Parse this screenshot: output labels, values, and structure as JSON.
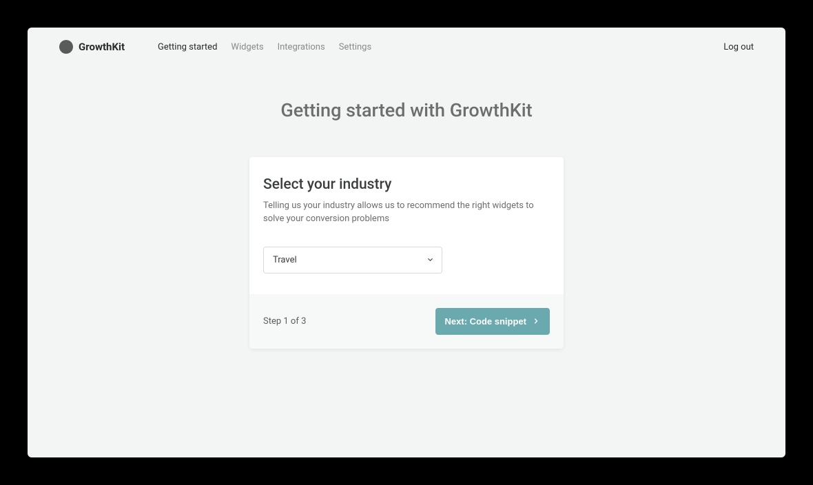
{
  "brand": "GrowthKit",
  "nav": {
    "items": [
      {
        "label": "Getting started",
        "active": true
      },
      {
        "label": "Widgets",
        "active": false
      },
      {
        "label": "Integrations",
        "active": false
      },
      {
        "label": "Settings",
        "active": false
      }
    ],
    "logout": "Log out"
  },
  "page": {
    "title": "Getting started with GrowthKit"
  },
  "card": {
    "title": "Select your industry",
    "description": "Telling us your industry allows us to recommend the right widgets to solve your conversion problems",
    "industry_selected": "Travel",
    "step_text": "Step 1 of 3",
    "next_label": "Next: Code snippet"
  },
  "colors": {
    "accent": "#6aa9ae"
  }
}
